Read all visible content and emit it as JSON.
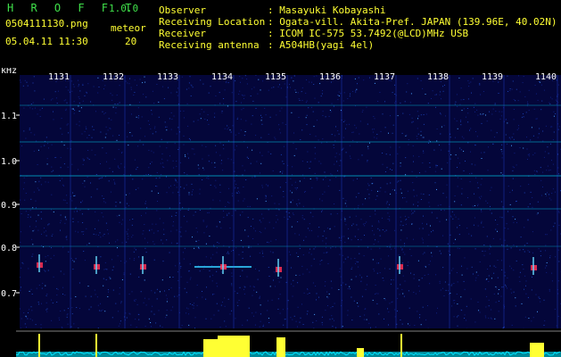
{
  "app": {
    "name": "H R O F F T",
    "version": "1.0.0"
  },
  "file": {
    "name": "0504111130.png",
    "timestamp": "05.04.11 11:30"
  },
  "meteor": {
    "label": "meteor",
    "count": "20"
  },
  "info": [
    {
      "key": "Observer",
      "value": ": Masayuki Kobayashi"
    },
    {
      "key": "Receiving Location",
      "value": ": Ogata-vill. Akita-Pref. JAPAN (139.96E, 40.02N)"
    },
    {
      "key": "Receiver",
      "value": ": ICOM IC-575 53.7492(@LCD)MHz USB"
    },
    {
      "key": "Receiving antenna",
      "value": ": A504HB(yagi 4el)"
    }
  ],
  "spectrogram": {
    "y_unit": "kHz",
    "y_ticks": [
      "1.1",
      "1.0",
      "0.9",
      "0.8",
      "0.7",
      "0.6"
    ],
    "time_ticks": [
      "1131",
      "1132",
      "1133",
      "1134",
      "1135",
      "1136",
      "1137",
      "1138",
      "1139",
      "1140"
    ],
    "colors": {
      "background": "#000030",
      "signal": "#00e5ff",
      "text": "#ffff33",
      "labels": "#ffffff"
    }
  }
}
